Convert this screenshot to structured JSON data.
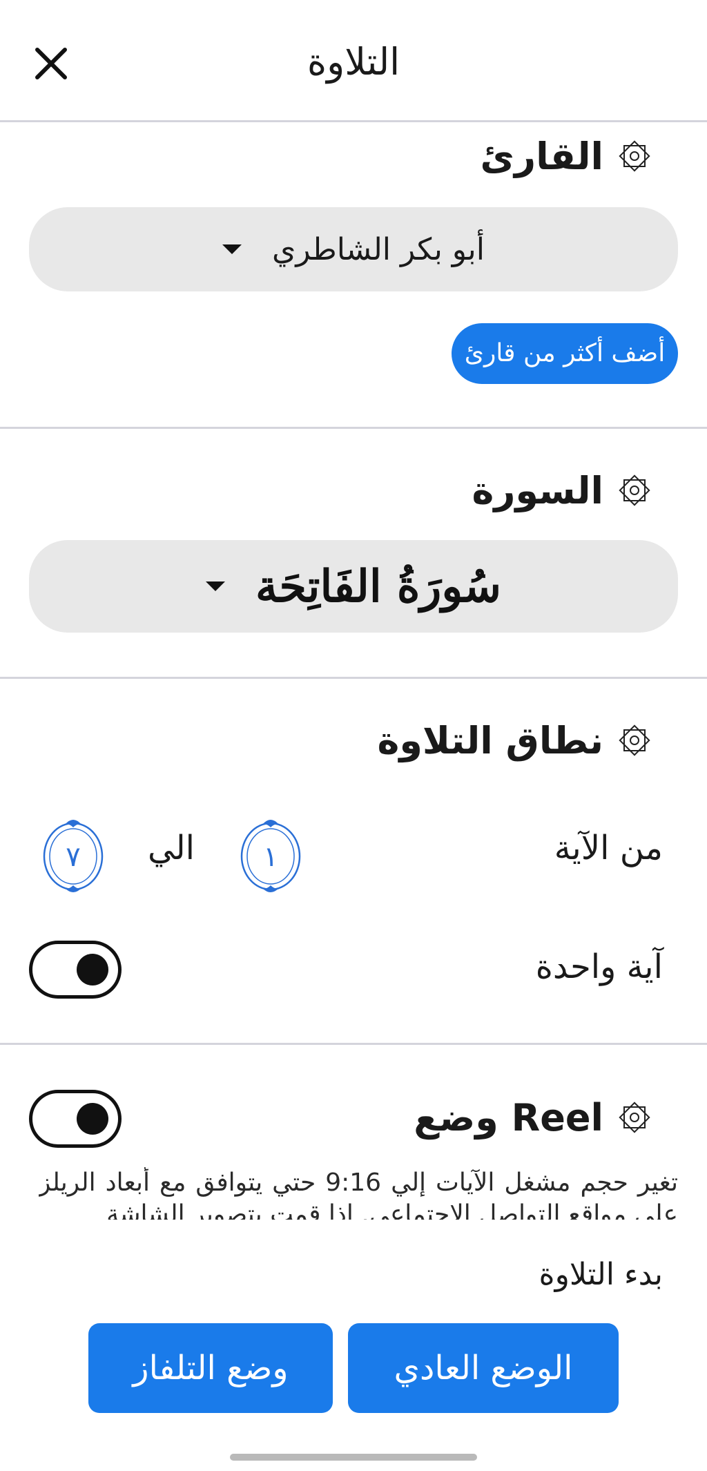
{
  "header": {
    "title": "التلاوة"
  },
  "reciter": {
    "title": "القارئ",
    "selected": "أبو بكر الشاطري",
    "add_button": "أضف أكثر من قارئ"
  },
  "surah": {
    "title": "السورة",
    "selected": "سُورَةُ الفَاتِحَة"
  },
  "range": {
    "title": "نطاق التلاوة",
    "from_label": "من الآية",
    "from_value": "١",
    "to_label": "الي",
    "to_value": "٧",
    "single_ayah_label": "آية واحدة",
    "single_ayah_on": true
  },
  "reel": {
    "title": "وضع Reel",
    "enabled": true,
    "description": "تغير حجم مشغل الآيات إلي 9:16 حتي يتوافق مع أبعاد الريلز علي مواقع التواصل الاجتماعي. إذا قمت بتصوير الشاشة"
  },
  "start": {
    "label": "بدء التلاوة",
    "normal_mode": "الوضع العادي",
    "tv_mode": "وضع التلفاز"
  },
  "colors": {
    "accent": "#1a7bea",
    "dropdown_bg": "#e8e8e8",
    "divider": "#d4d4dc"
  }
}
